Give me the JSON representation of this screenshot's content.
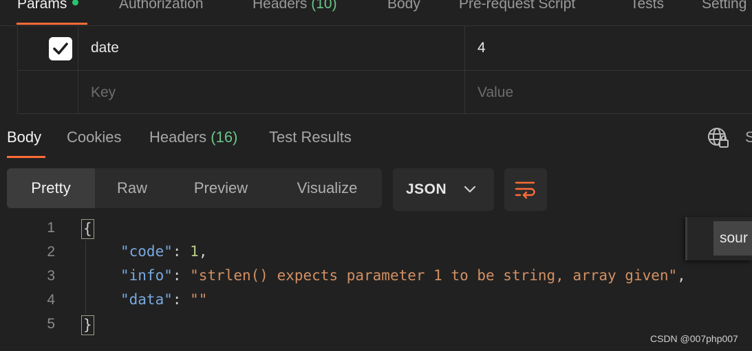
{
  "request_tabs": [
    {
      "label": "Params",
      "count": ""
    },
    {
      "label": "Authorization",
      "count": ""
    },
    {
      "label": "Headers",
      "count": "(10)"
    },
    {
      "label": "Body",
      "count": ""
    },
    {
      "label": "Pre-request Script",
      "count": ""
    },
    {
      "label": "Tests",
      "count": ""
    },
    {
      "label": "Setting",
      "count": ""
    }
  ],
  "params": {
    "rows": [
      {
        "checked": true,
        "key": "date",
        "value": "4"
      }
    ],
    "key_placeholder": "Key",
    "value_placeholder": "Value"
  },
  "response_tabs": [
    {
      "label": "Body",
      "count": ""
    },
    {
      "label": "Cookies",
      "count": ""
    },
    {
      "label": "Headers",
      "count": "(16)"
    },
    {
      "label": "Test Results",
      "count": ""
    }
  ],
  "response_right_label": "S",
  "view_modes": [
    "Pretty",
    "Raw",
    "Preview",
    "Visualize"
  ],
  "format": "JSON",
  "code": {
    "line_numbers": [
      "1",
      "2",
      "3",
      "4",
      "5"
    ],
    "open_brace": "{",
    "close_brace": "}",
    "entries": [
      {
        "key": "\"code\"",
        "value": "1",
        "type": "num",
        "trail": ","
      },
      {
        "key": "\"info\"",
        "value": "\"strlen() expects parameter 1 to be string, array given\"",
        "type": "str",
        "trail": ","
      },
      {
        "key": "\"data\"",
        "value": "\"\"",
        "type": "str",
        "trail": ""
      }
    ]
  },
  "popup_text": "sour",
  "watermark": "CSDN @007php007",
  "colors": {
    "accent": "#ff6c37",
    "count_green": "#6cc58a",
    "active_dot": "#27c46b"
  }
}
